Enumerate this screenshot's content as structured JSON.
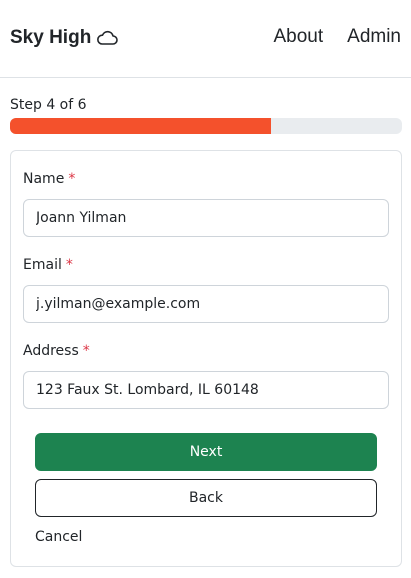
{
  "header": {
    "brand": "Sky High",
    "brand_icon": "cloud-icon",
    "nav": [
      {
        "label": "About"
      },
      {
        "label": "Admin"
      }
    ]
  },
  "progress": {
    "label": "Step 4 of 6",
    "current_step": 4,
    "total_steps": 6,
    "fraction": 0.667,
    "color": "#f4512c"
  },
  "form": {
    "required_marker": "*",
    "fields": [
      {
        "label": "Name",
        "value": "Joann Yilman"
      },
      {
        "label": "Email",
        "value": "j.yilman@example.com"
      },
      {
        "label": "Address",
        "value": "123 Faux St. Lombard, IL 60148"
      }
    ],
    "next_label": "Next",
    "back_label": "Back",
    "cancel_label": "Cancel"
  },
  "colors": {
    "primary": "#1d8350",
    "required": "#dc3545"
  }
}
